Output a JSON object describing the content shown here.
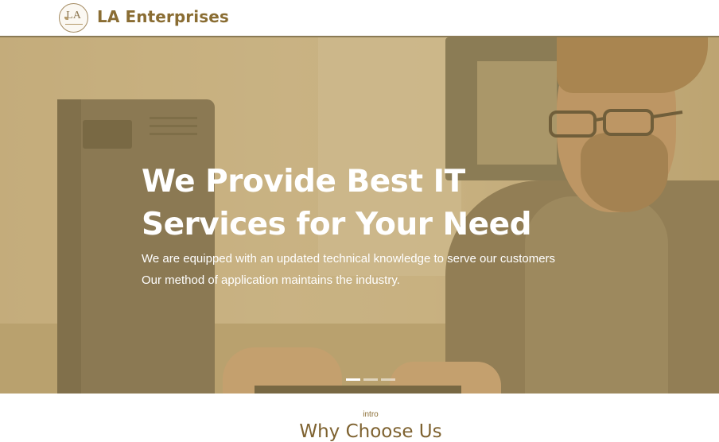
{
  "header": {
    "logo_monogram": "LA",
    "brand_name": "LA Enterprises"
  },
  "hero": {
    "title_line1": "We Provide Best IT",
    "title_line2": "Services for Your Need",
    "subtitle_line1": "We are equipped with an updated technical knowledge to serve our customers",
    "subtitle_line2": "Our method of application maintains the industry.",
    "slides": [
      {
        "active": true
      },
      {
        "active": false
      },
      {
        "active": false
      }
    ]
  },
  "intro": {
    "label": "intro",
    "title": "Why Choose Us"
  },
  "colors": {
    "brand": "#8a6d33",
    "overlay": "#b09252",
    "text_light": "#ffffff"
  }
}
